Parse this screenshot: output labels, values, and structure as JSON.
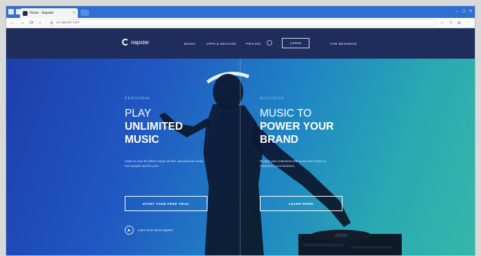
{
  "browser": {
    "tab_title": "Home - Napster",
    "tab_close": "×",
    "url": "us.napster.com",
    "nav": {
      "back": "←",
      "forward": "→",
      "refresh": "⟳",
      "home": "⌂"
    },
    "window_controls": {
      "minimize": "–",
      "maximize": "□",
      "close": "×"
    },
    "tools": [
      "☆",
      "≡",
      "⚙",
      "⋮"
    ]
  },
  "site": {
    "logo_text": "napster",
    "nav_links": [
      "MUSIC",
      "APPS & DEVICES",
      "PRICING"
    ],
    "login_label": "LOGIN",
    "for_business_label": "FOR BUSINESS"
  },
  "personal": {
    "label": "PERSONAL",
    "headline_light": "PLAY",
    "headline_bold_1": "UNLIMITED",
    "headline_bold_2": "MUSIC",
    "body": "Listen to over 30 million songs ad-free, and discover music from people and the pros.",
    "cta": "START YOUR FREE TRIAL",
    "learn_more": "Learn more about Napster"
  },
  "business": {
    "label": "BUSINESS",
    "headline_light_1": "MUSIC TO",
    "headline_bold_1": "POWER YOUR",
    "headline_bold_2": "BRAND",
    "body": "Engage your customers with music and create an experience your business.",
    "cta": "LEARN MORE"
  },
  "colors": {
    "nav_bg": "#1e2d5c",
    "gradient_start": "#1c3da8",
    "gradient_end": "#37b7a8",
    "label_accent": "#7dc7f0"
  }
}
